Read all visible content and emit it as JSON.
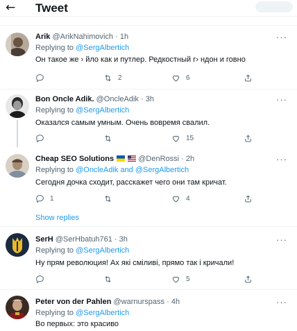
{
  "header": {
    "back_icon": "←",
    "title": "Tweet"
  },
  "tweets": [
    {
      "name": "Arik",
      "handle": "@ArikNahimovich",
      "dot": "·",
      "time": "1h",
      "replying_prefix": "Replying to ",
      "replying_to": "@SergAlbertich",
      "text": "Он такое же › йло как и путлер. Редкостный г› ндон и говно",
      "replies": "",
      "retweets": "2",
      "likes": "6"
    },
    {
      "name": "Bon Oncle Adik.",
      "handle": "@OncleAdik",
      "dot": "·",
      "time": "3h",
      "replying_prefix": "Replying to ",
      "replying_to": "@SergAlbertich",
      "text": "Оказался самым умным. Очень вовремя свалил.",
      "replies": "",
      "retweets": "",
      "likes": "15"
    },
    {
      "name": "Cheap SEO Solutions",
      "handle": "@DenRossi",
      "dot": "·",
      "time": "2h",
      "replying_prefix": "Replying to ",
      "replying_to": "@OncleAdik and @SergAlbertich",
      "text": "Сегодня дочка сходит, расскажет чего они там кричат.",
      "replies": "1",
      "retweets": "",
      "likes": "4"
    },
    {
      "name": "SerH",
      "handle": "@SerHbatuh761",
      "dot": "·",
      "time": "3h",
      "replying_prefix": "Replying to ",
      "replying_to": "@SergAlbertich",
      "text": "Ну прям революция!  Ах які сміливі, прямо так і кричали!",
      "replies": "",
      "retweets": "",
      "likes": "5"
    },
    {
      "name": "Peter von der Pahlen",
      "handle": "@warnurspass",
      "dot": "·",
      "time": "4h",
      "replying_prefix": "Replying to ",
      "replying_to": "@SergAlbertich",
      "text": "Во первых: это красиво"
    }
  ],
  "show_replies": "Show replies",
  "more_icon": "···",
  "colors": {
    "link": "#1d9bf0",
    "muted": "#536471",
    "text": "#0f1419",
    "divider": "#eff3f4"
  }
}
